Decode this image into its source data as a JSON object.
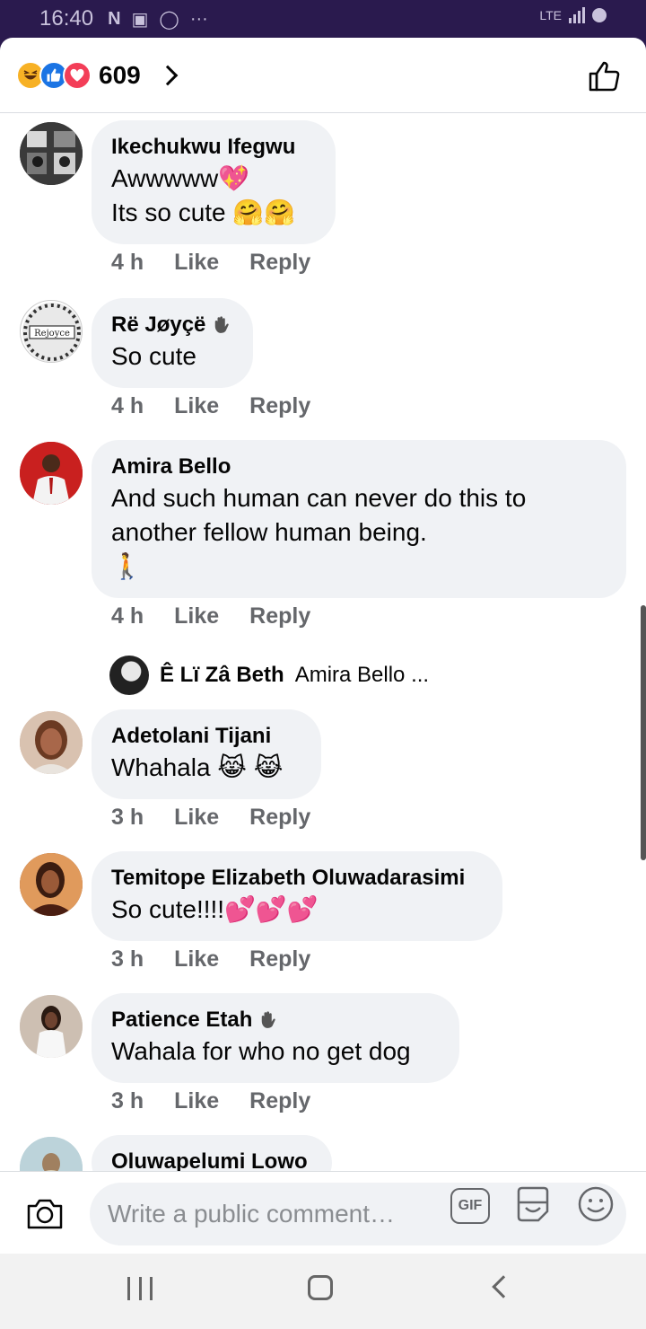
{
  "status_bar": {
    "time": "16:40",
    "network": "LTE"
  },
  "header": {
    "reaction_count": "609",
    "reactions": [
      "haha-icon",
      "like-icon",
      "love-icon"
    ]
  },
  "comments": [
    {
      "author": "Ikechukwu Ifegwu",
      "lines": [
        "Awwwww💖",
        "Its so cute 🤗🤗"
      ],
      "time": "4 h",
      "like": "Like",
      "reply": "Reply"
    },
    {
      "author": "Rë Jøyçë",
      "lines": [
        "So cute"
      ],
      "time": "4 h",
      "like": "Like",
      "reply": "Reply"
    },
    {
      "author": "Amira Bello",
      "lines": [
        "And such human can never do this to",
        "another fellow human being.",
        "🚶"
      ],
      "time": "4 h",
      "like": "Like",
      "reply": "Reply",
      "reply_preview": {
        "name": "Ê Lï Zâ Beth",
        "text": "Amira Bello ..."
      }
    },
    {
      "author": "Adetolani Tijani",
      "lines": [
        "Whahala 😹 😹"
      ],
      "time": "3 h",
      "like": "Like",
      "reply": "Reply"
    },
    {
      "author": "Temitope Elizabeth Oluwadarasimi",
      "lines": [
        "So cute!!!!💕💕💕"
      ],
      "time": "3 h",
      "like": "Like",
      "reply": "Reply"
    },
    {
      "author": "Patience Etah",
      "lines": [
        "Wahala for who no get dog"
      ],
      "time": "3 h",
      "like": "Like",
      "reply": "Reply"
    },
    {
      "author": "Oluwapelumi Lowo",
      "lines": []
    }
  ],
  "composer": {
    "placeholder": "Write a public comment…",
    "gif_label": "GIF"
  }
}
